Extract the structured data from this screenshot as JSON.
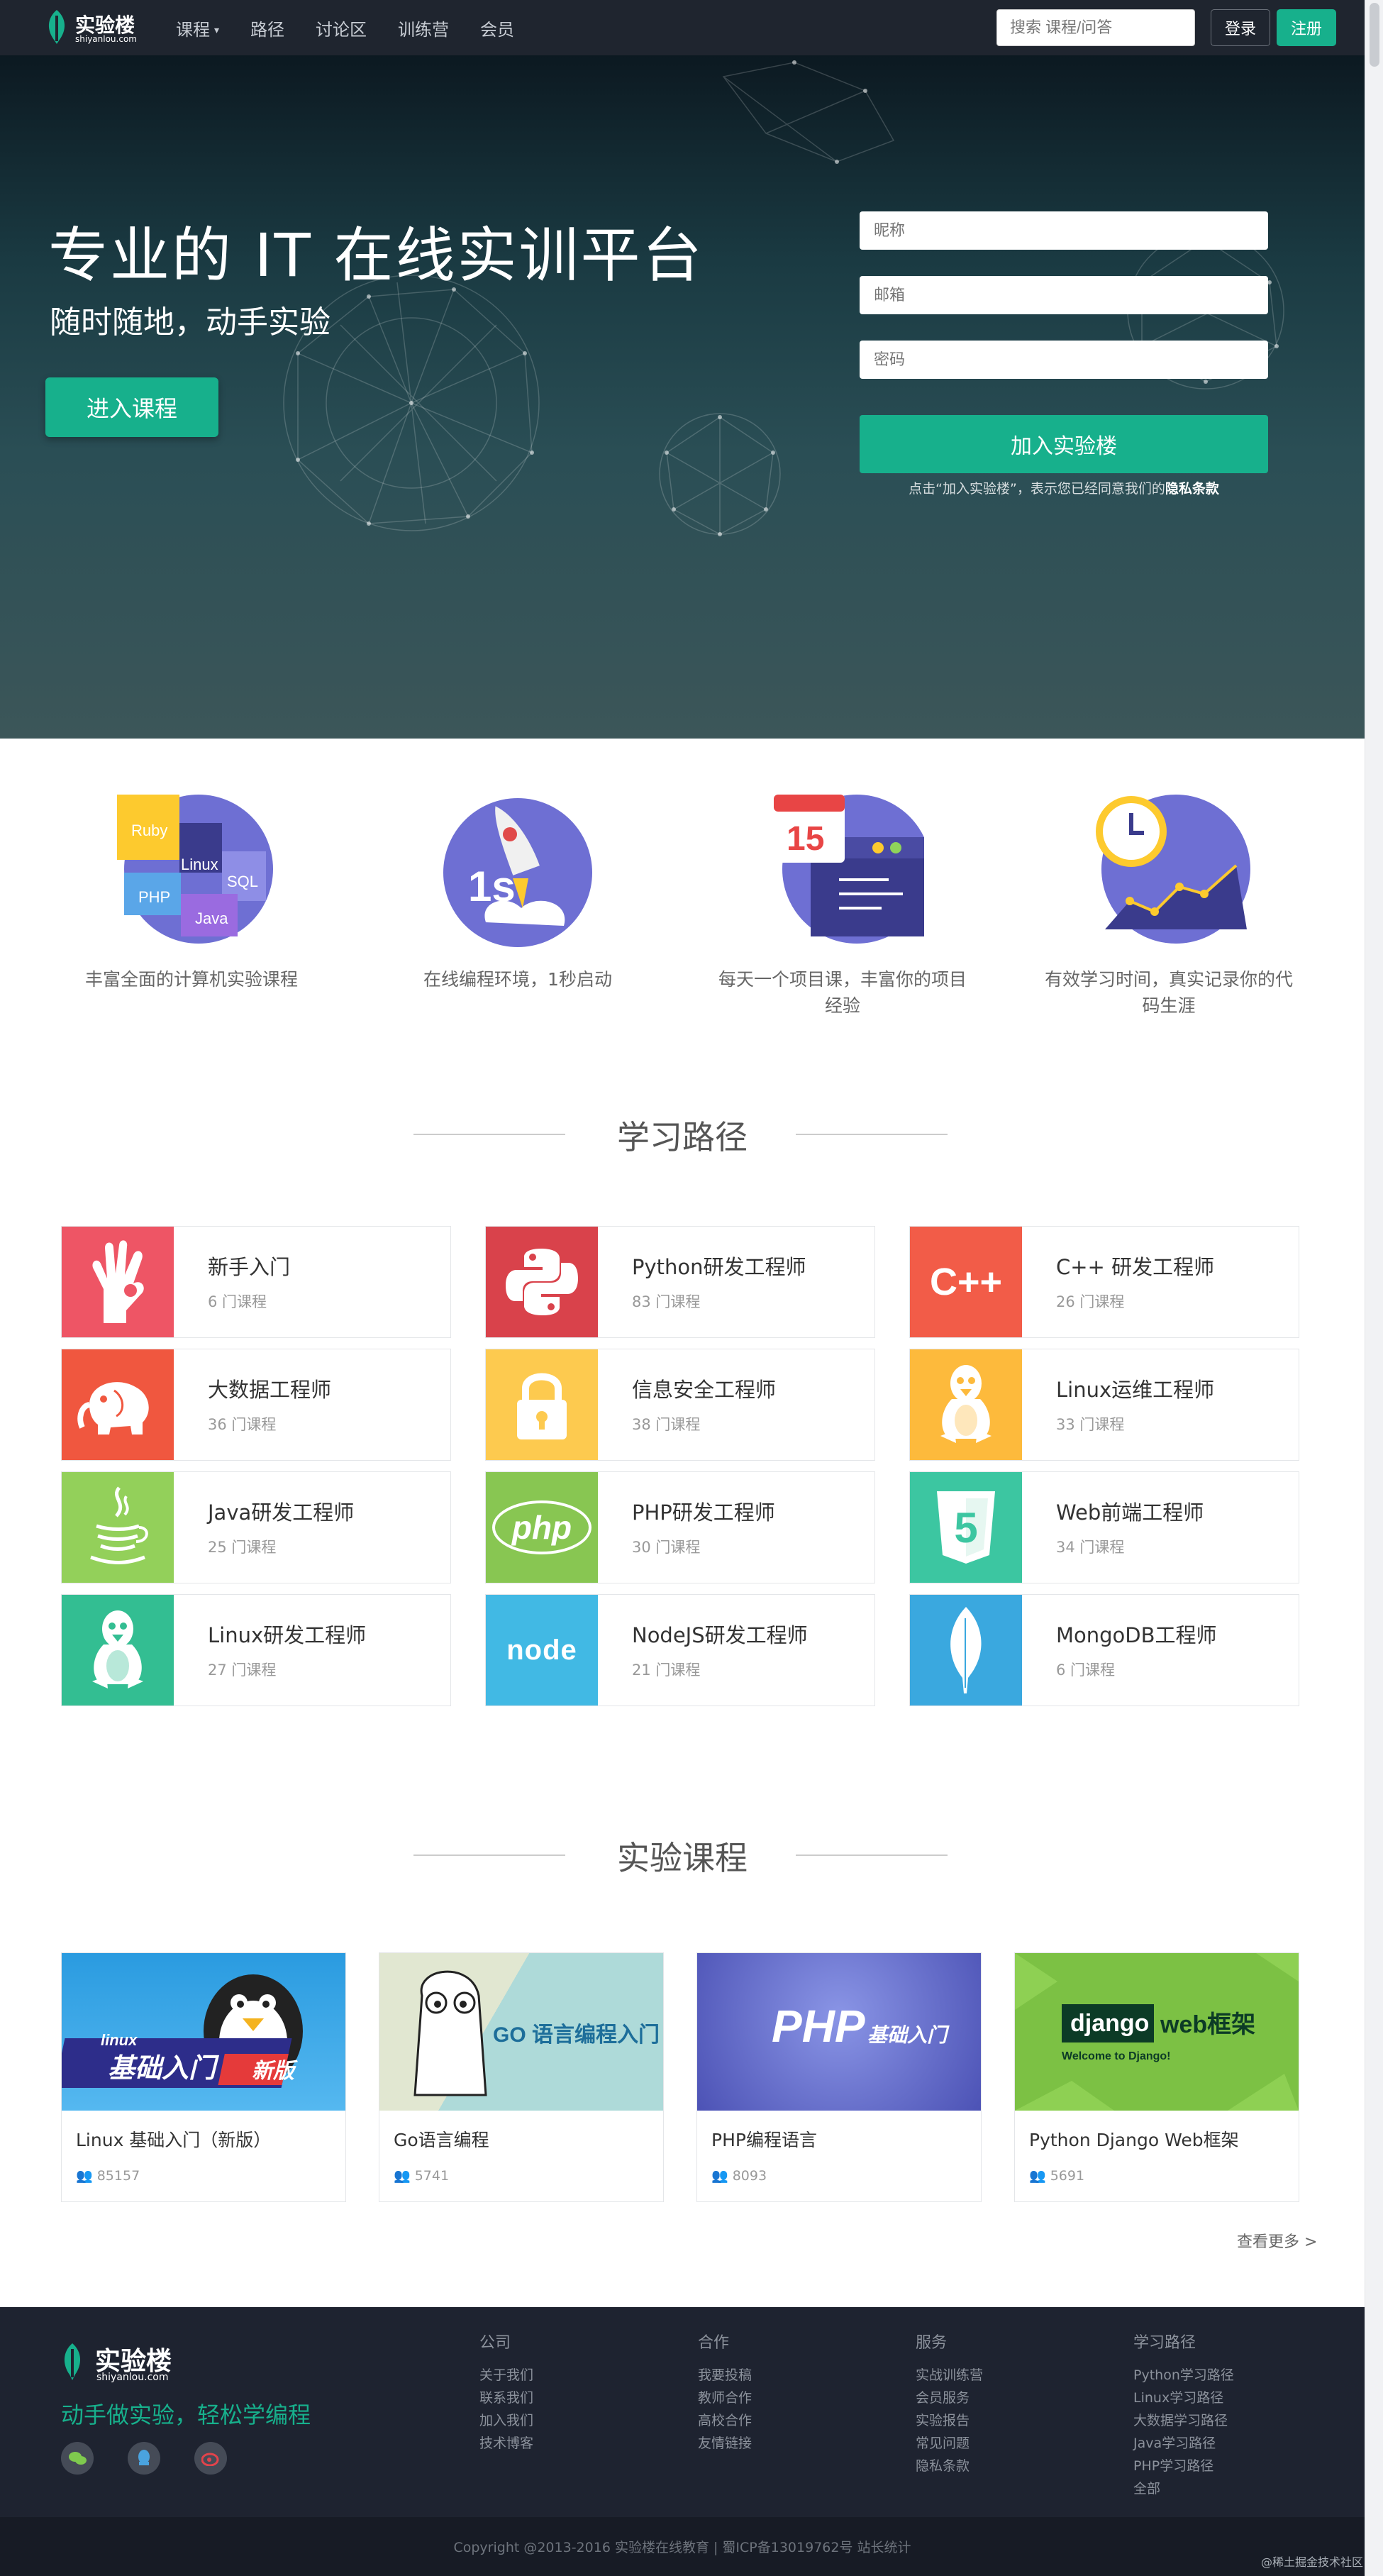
{
  "navbar": {
    "logo_text": "实验楼",
    "logo_sub": "shiyanlou.com",
    "nav_items": [
      "课程",
      "路径",
      "讨论区",
      "训练营",
      "会员"
    ],
    "search_placeholder": "搜索 课程/问答",
    "login_label": "登录",
    "register_label": "注册"
  },
  "hero": {
    "title": "专业的 IT 在线实训平台",
    "subtitle": "随时随地，动手实验",
    "cta_label": "进入课程",
    "form": {
      "nickname_placeholder": "昵称",
      "email_placeholder": "邮箱",
      "password_placeholder": "密码",
      "submit_label": "加入实验楼",
      "terms_prefix": "点击“加入实验楼”，表示您已经同意我们的",
      "terms_link": "隐私条款"
    }
  },
  "features": [
    {
      "text": "丰富全面的计算机实验课程",
      "icon": "course-tags-icon",
      "tags": [
        "Ruby",
        "Linux",
        "SQL",
        "PHP",
        "Java"
      ]
    },
    {
      "text": "在线编程环境，1秒启动",
      "icon": "rocket-icon",
      "label": "1s"
    },
    {
      "text": "每天一个项目课，丰富你的项目经验",
      "icon": "calendar-icon",
      "label": "15"
    },
    {
      "text": "有效学习时间，真实记录你的代码生涯",
      "icon": "clock-chart-icon"
    }
  ],
  "paths_section": {
    "title": "学习路径",
    "items": [
      {
        "name": "新手入门",
        "count": "6 门课程",
        "color": "#ee5565",
        "icon": "ok-hand-icon"
      },
      {
        "name": "Python研发工程师",
        "count": "83 门课程",
        "color": "#d9424b",
        "icon": "python-icon"
      },
      {
        "name": "C++ 研发工程师",
        "count": "26 门课程",
        "color": "#f25c48",
        "icon": "cpp-icon",
        "label": "C++"
      },
      {
        "name": "大数据工程师",
        "count": "36 门课程",
        "color": "#f0573f",
        "icon": "hadoop-elephant-icon"
      },
      {
        "name": "信息安全工程师",
        "count": "38 门课程",
        "color": "#fdca4f",
        "icon": "lock-icon"
      },
      {
        "name": "Linux运维工程师",
        "count": "33 门课程",
        "color": "#fdba3c",
        "icon": "tux-icon"
      },
      {
        "name": "Java研发工程师",
        "count": "25 门课程",
        "color": "#93d05a",
        "icon": "java-cup-icon"
      },
      {
        "name": "PHP研发工程师",
        "count": "30 门课程",
        "color": "#88c652",
        "icon": "php-icon",
        "label": "php"
      },
      {
        "name": "Web前端工程师",
        "count": "34 门课程",
        "color": "#3cc6a1",
        "icon": "html5-icon",
        "label": "5"
      },
      {
        "name": "Linux研发工程师",
        "count": "27 门课程",
        "color": "#33be92",
        "icon": "tux-icon"
      },
      {
        "name": "NodeJS研发工程师",
        "count": "21 门课程",
        "color": "#41b9e4",
        "icon": "nodejs-icon",
        "label": "node"
      },
      {
        "name": "MongoDB工程师",
        "count": "6 门课程",
        "color": "#3aa8df",
        "icon": "mongodb-leaf-icon"
      }
    ]
  },
  "courses_section": {
    "title": "实验课程",
    "items": [
      {
        "name": "Linux 基础入门（新版）",
        "count": "85157",
        "thumb_text": "基础入门",
        "thumb_tag": "新版",
        "thumb_small": "linux"
      },
      {
        "name": "Go语言编程",
        "count": "5741",
        "thumb_text": "GO 语言编程入门"
      },
      {
        "name": "PHP编程语言",
        "count": "8093",
        "thumb_text": "PHP",
        "thumb_small": "基础入门"
      },
      {
        "name": "Python Django Web框架",
        "count": "5691",
        "thumb_text": "django",
        "thumb_tag": "web框架",
        "thumb_small": "Welcome to Django!"
      }
    ],
    "see_more": "查看更多 >"
  },
  "footer": {
    "logo_text": "实验楼",
    "logo_sub": "shiyanlou.com",
    "slogan": "动手做实验，轻松学编程",
    "social_icons": [
      "wechat-icon",
      "qq-icon",
      "weibo-icon"
    ],
    "columns": [
      {
        "title": "公司",
        "links": [
          "关于我们",
          "联系我们",
          "加入我们",
          "技术博客"
        ]
      },
      {
        "title": "合作",
        "links": [
          "我要投稿",
          "教师合作",
          "高校合作",
          "友情链接"
        ]
      },
      {
        "title": "服务",
        "links": [
          "实战训练营",
          "会员服务",
          "实验报告",
          "常见问题",
          "隐私条款"
        ]
      },
      {
        "title": "学习路径",
        "links": [
          "Python学习路径",
          "Linux学习路径",
          "大数据学习路径",
          "Java学习路径",
          "PHP学习路径",
          "全部"
        ]
      }
    ],
    "copyright": "Copyright @2013-2016 实验楼在线教育 | 蜀ICP备13019762号 站长统计",
    "watermark": "@稀土掘金技术社区"
  },
  "colors": {
    "accent": "#17b08c",
    "nav_bg": "#1f252f",
    "footer_bg": "#1e2330"
  }
}
